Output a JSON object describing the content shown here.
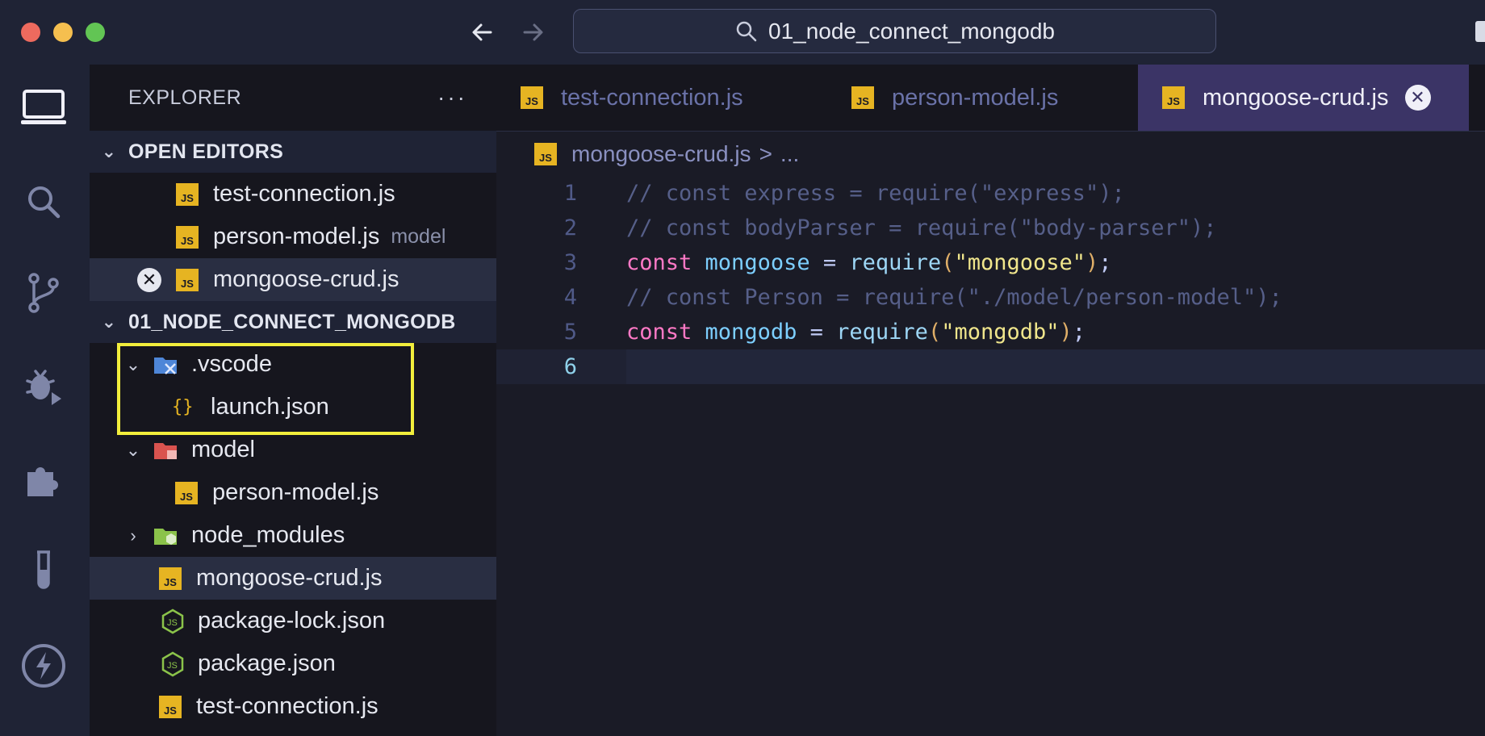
{
  "titlebar": {
    "search_text": "01_node_connect_mongodb"
  },
  "activity_bar": {
    "items": [
      "explorer-icon",
      "search-icon",
      "source-control-icon",
      "debug-icon",
      "extensions-icon",
      "testing-icon",
      "remote-icon"
    ]
  },
  "sidebar": {
    "title": "EXPLORER",
    "more_label": "···",
    "open_editors": {
      "title": "OPEN EDITORS",
      "items": [
        {
          "name": "test-connection.js",
          "desc": ""
        },
        {
          "name": "person-model.js",
          "desc": "model"
        },
        {
          "name": "mongoose-crud.js",
          "desc": ""
        }
      ]
    },
    "workspace": {
      "title": "01_NODE_CONNECT_MONGODB",
      "items": [
        {
          "name": ".vscode",
          "type": "folder-open"
        },
        {
          "name": "launch.json",
          "type": "json"
        },
        {
          "name": "model",
          "type": "folder-open"
        },
        {
          "name": "person-model.js",
          "type": "js"
        },
        {
          "name": "node_modules",
          "type": "folder-closed"
        },
        {
          "name": "mongoose-crud.js",
          "type": "js"
        },
        {
          "name": "package-lock.json",
          "type": "node"
        },
        {
          "name": "package.json",
          "type": "node"
        },
        {
          "name": "test-connection.js",
          "type": "js"
        }
      ]
    }
  },
  "tabs": [
    {
      "label": "test-connection.js",
      "active": false
    },
    {
      "label": "person-model.js",
      "active": false
    },
    {
      "label": "mongoose-crud.js",
      "active": true
    }
  ],
  "breadcrumb": {
    "file": "mongoose-crud.js",
    "separator": ">",
    "rest": "..."
  },
  "badges": {
    "js": "JS",
    "close": "✕"
  },
  "code": {
    "line_numbers": [
      "1",
      "2",
      "3",
      "4",
      "5",
      "6"
    ],
    "lines": [
      "// const express = require(\"express\");",
      "// const bodyParser = require(\"body-parser\");",
      "const mongoose = require(\"mongoose\");",
      "// const Person = require(\"./model/person-model\");",
      "const mongodb = require(\"mongodb\");",
      ""
    ],
    "current_line": 6
  },
  "colors": {
    "accent_tab": "#3b3466",
    "highlight": "#f2ee3c",
    "js_yellow": "#e6b422"
  }
}
